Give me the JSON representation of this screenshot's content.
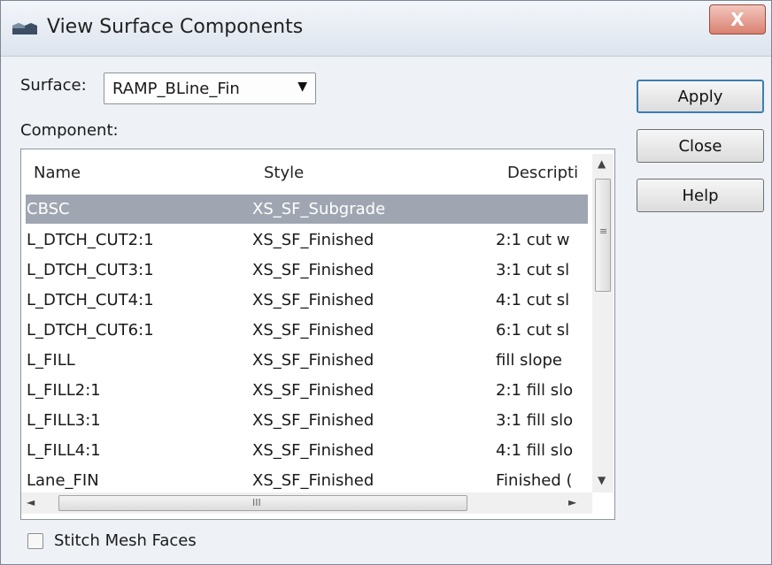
{
  "window": {
    "title": "View Surface Components",
    "close_glyph": "X"
  },
  "surface": {
    "label": "Surface:",
    "value": "RAMP_BLine_Fin",
    "arrow": "▼"
  },
  "component": {
    "label": "Component:",
    "columns": {
      "name": "Name",
      "style": "Style",
      "description": "Descripti"
    },
    "rows": [
      {
        "name": "CBSC",
        "style": "XS_SF_Subgrade",
        "description": "",
        "selected": true
      },
      {
        "name": "L_DTCH_CUT2:1",
        "style": "XS_SF_Finished",
        "description": "2:1 cut w"
      },
      {
        "name": "L_DTCH_CUT3:1",
        "style": "XS_SF_Finished",
        "description": "3:1 cut sl"
      },
      {
        "name": "L_DTCH_CUT4:1",
        "style": "XS_SF_Finished",
        "description": "4:1 cut sl"
      },
      {
        "name": "L_DTCH_CUT6:1",
        "style": "XS_SF_Finished",
        "description": "6:1 cut sl"
      },
      {
        "name": "L_FILL",
        "style": "XS_SF_Finished",
        "description": "fill slope"
      },
      {
        "name": "L_FILL2:1",
        "style": "XS_SF_Finished",
        "description": "2:1 fill slo"
      },
      {
        "name": "L_FILL3:1",
        "style": "XS_SF_Finished",
        "description": "3:1 fill slo"
      },
      {
        "name": "L_FILL4:1",
        "style": "XS_SF_Finished",
        "description": "4:1 fill slo"
      },
      {
        "name": "Lane_FIN",
        "style": "XS_SF_Finished",
        "description": "Finished ("
      }
    ]
  },
  "buttons": {
    "apply": "Apply",
    "close": "Close",
    "help": "Help"
  },
  "stitch_mesh": {
    "label": "Stitch Mesh Faces",
    "checked": false
  },
  "icons": {
    "scroll_up": "▲",
    "scroll_down": "▼",
    "scroll_left": "◄",
    "scroll_right": "►",
    "vgrip": "≡",
    "hgrip": "III"
  },
  "colors": {
    "selection": "#9fa6b2",
    "close_button": "#d98171",
    "default_button_border": "#3c7fb1"
  }
}
